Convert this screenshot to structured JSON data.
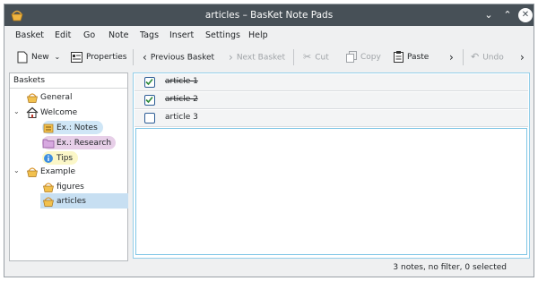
{
  "window": {
    "title": "articles – BasKet Note Pads"
  },
  "menu": [
    "Basket",
    "Edit",
    "Go",
    "Note",
    "Tags",
    "Insert",
    "Settings",
    "Help"
  ],
  "toolbar": {
    "new": "New",
    "properties": "Properties",
    "previous_basket": "Previous Basket",
    "next_basket": "Next Basket",
    "cut": "Cut",
    "copy": "Copy",
    "paste": "Paste",
    "undo": "Undo"
  },
  "baskets": {
    "header": "Baskets",
    "items": [
      {
        "label": "General",
        "icon": "basket-icon"
      },
      {
        "label": "Welcome",
        "icon": "home-icon"
      },
      {
        "label": "Ex.: Notes",
        "icon": "note-basket-icon",
        "highlight": "#cfe6f6"
      },
      {
        "label": "Ex.: Research",
        "icon": "folder-icon",
        "highlight": "#e7cfe8"
      },
      {
        "label": "Tips",
        "icon": "info-icon",
        "highlight": "#fbf7c8"
      },
      {
        "label": "Example",
        "icon": "basket-icon"
      },
      {
        "label": "figures",
        "icon": "basket-icon"
      },
      {
        "label": "articles",
        "icon": "basket-icon",
        "selected": true
      }
    ]
  },
  "notes": [
    {
      "text": "article 1",
      "checked": true
    },
    {
      "text": "article 2",
      "checked": true
    },
    {
      "text": "article 3",
      "checked": false
    }
  ],
  "status": "3 notes, no filter, 0 selected",
  "colors": {
    "titlebar": "#475057",
    "selection": "#c7dff2",
    "focus_border": "#93cee9",
    "check": "#2d5d96"
  }
}
